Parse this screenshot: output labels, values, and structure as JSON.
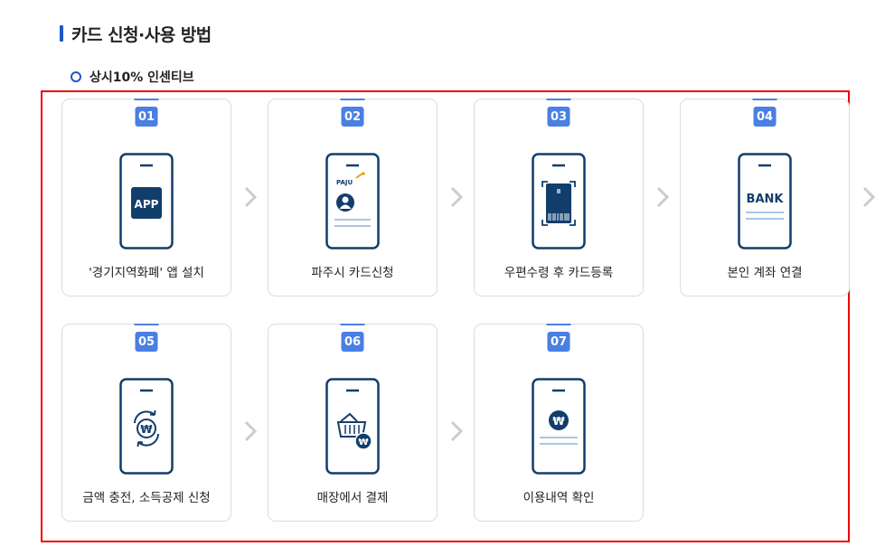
{
  "page": {
    "section_title": "카드 신청·사용 방법",
    "sub_title": "상시10% 인센티브"
  },
  "steps": [
    {
      "num": "01",
      "label": "'경기지역화폐' 앱 설치",
      "icon": "app-phone-icon",
      "screen_text": "APP"
    },
    {
      "num": "02",
      "label": "파주시 카드신청",
      "icon": "paju-profile-phone-icon",
      "screen_text": "PAJU"
    },
    {
      "num": "03",
      "label": "우편수령 후 카드등록",
      "icon": "card-scan-phone-icon"
    },
    {
      "num": "04",
      "label": "본인 계좌 연결",
      "icon": "bank-phone-icon",
      "screen_text": "BANK"
    },
    {
      "num": "05",
      "label": "금액 충전, 소득공제 신청",
      "icon": "won-recharge-phone-icon",
      "screen_text": "₩"
    },
    {
      "num": "06",
      "label": "매장에서 결제",
      "icon": "basket-pay-phone-icon",
      "screen_text": "₩"
    },
    {
      "num": "07",
      "label": "이용내역 확인",
      "icon": "won-history-phone-icon",
      "screen_text": "₩"
    }
  ],
  "colors": {
    "accent": "#1e57c9",
    "badge": "#4a7fe3",
    "phone_outline": "#123e6b",
    "highlight_frame": "#ee0000",
    "chevron": "#cccccc"
  }
}
